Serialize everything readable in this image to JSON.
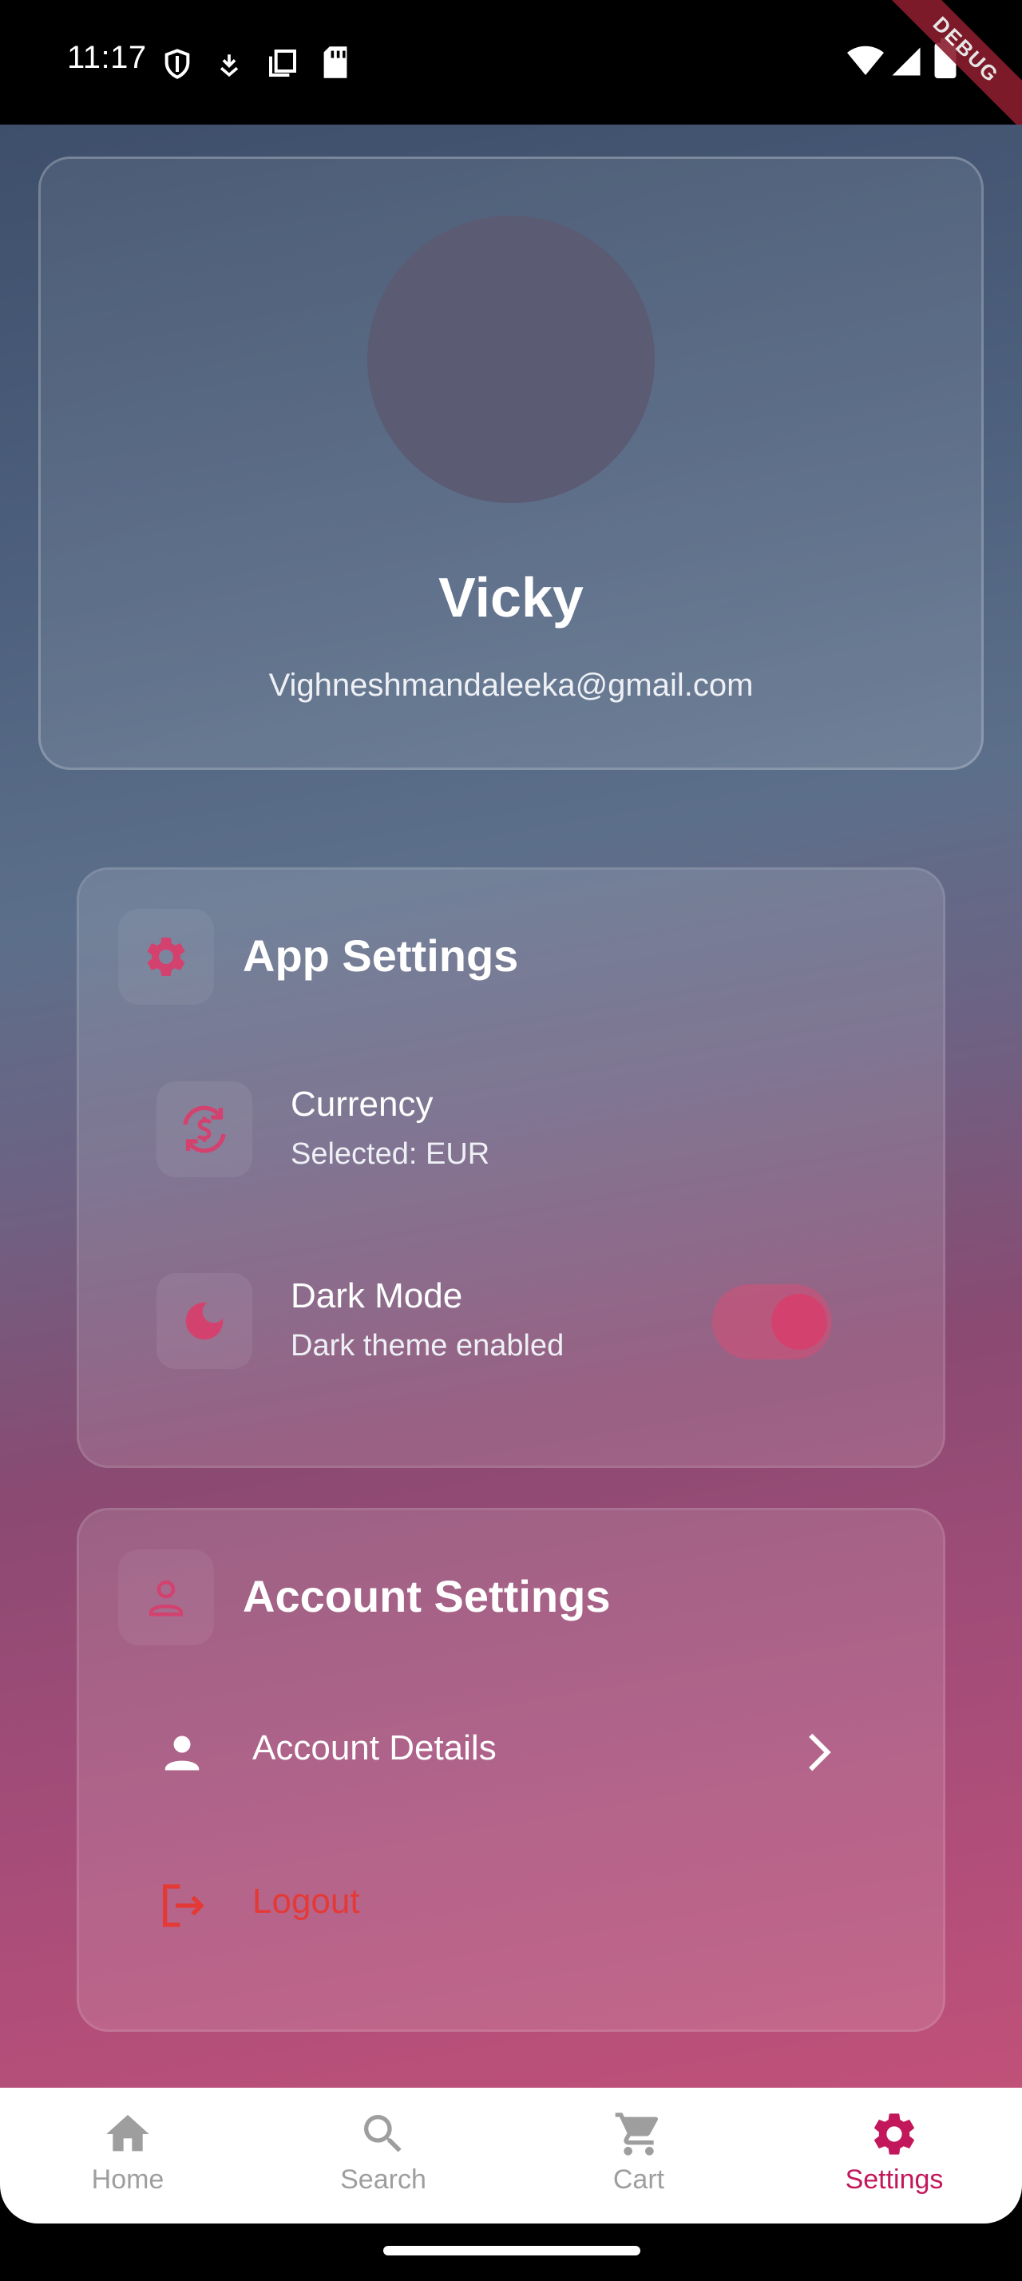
{
  "status_bar": {
    "time": "11:17",
    "debug_label": "DEBUG",
    "icons": [
      "shield-icon",
      "download-icon",
      "copy-icon",
      "sd-card-icon",
      "wifi-icon",
      "signal-icon",
      "battery-icon"
    ]
  },
  "profile": {
    "name": "Vicky",
    "email": "Vighneshmandaleeka@gmail.com"
  },
  "app_settings": {
    "title": "App Settings",
    "icon": "gear-icon",
    "currency": {
      "title": "Currency",
      "subtitle": "Selected: EUR",
      "icon": "currency-exchange-icon"
    },
    "dark_mode": {
      "title": "Dark Mode",
      "subtitle": "Dark theme enabled",
      "icon": "moon-icon",
      "enabled": true
    }
  },
  "account_settings": {
    "title": "Account Settings",
    "icon": "person-outline-icon",
    "account_details": {
      "label": "Account Details",
      "icon": "person-icon"
    },
    "logout": {
      "label": "Logout",
      "icon": "logout-icon"
    }
  },
  "bottom_nav": {
    "items": [
      {
        "label": "Home",
        "icon": "home-icon",
        "active": false
      },
      {
        "label": "Search",
        "icon": "search-icon",
        "active": false
      },
      {
        "label": "Cart",
        "icon": "cart-icon",
        "active": false
      },
      {
        "label": "Settings",
        "icon": "gear-icon",
        "active": true
      }
    ]
  },
  "colors": {
    "accent": "#d3426f",
    "logout": "#e53935",
    "nav_inactive": "#9e9e9e"
  }
}
